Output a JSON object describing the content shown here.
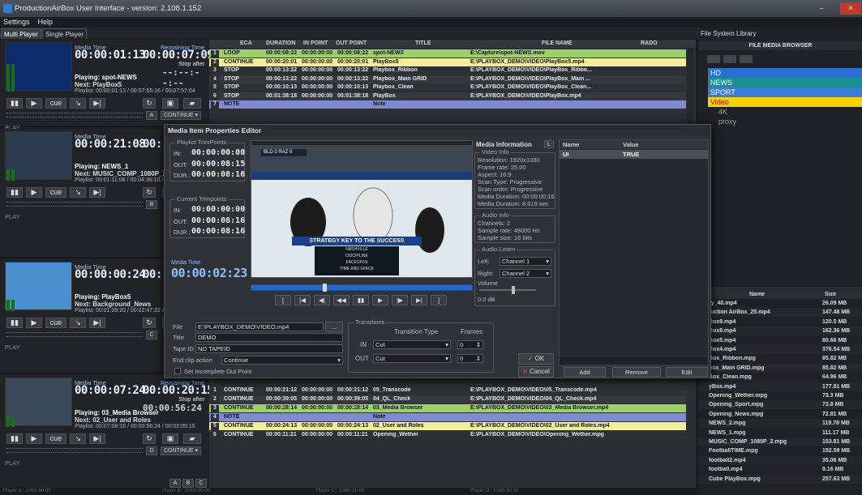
{
  "window": {
    "title": "ProductionAirBox User Interface - version: 2.108.1.152",
    "min": "–",
    "max": "□",
    "close": "✕"
  },
  "menu": [
    "Settings",
    "Help"
  ],
  "tabs": [
    "Multi Player",
    "Single Player"
  ],
  "players": [
    {
      "media_label": "Media Time",
      "media_time": "00:00:01:13",
      "remain_label": "Remaining Time",
      "remain_time": "00:00:07:09",
      "stop_after": "Stop after",
      "dashes": "--:--:--:--",
      "playing": "Playing: spot-NEWS",
      "next": "Next: PlayBox5",
      "playlist": "Playlist: 00:00:01:13 / 00:07:55:16 / 00:07:57:04",
      "letter": "A",
      "cont": "CONTINUE",
      "state": "PLAY"
    },
    {
      "media_label": "Media Time",
      "media_time": "00:00:21:08",
      "remain_label": "",
      "remain_time": "00:",
      "playing": "Playing: NEWS_1",
      "next": "Next: MUSIC_COMP_1080P_2",
      "playlist": "Playlist: 00:01:11:08 / 00:04:36:10 /",
      "letter": "B",
      "state": "PLAY"
    },
    {
      "media_label": "Media Time",
      "media_time": "00:00:00:24",
      "remain_label": "",
      "remain_time": "00:",
      "remain_time2": "00:",
      "playing": "Playing: PlayBox5",
      "next": "Next: Background_News",
      "playlist": "Playlist: 00:01:09:20 / 00:02:47:22 /",
      "letter": "C",
      "state": "PLAY"
    },
    {
      "media_label": "Media Time",
      "media_time": "00:00:07:24",
      "remain_label": "Remaining Time",
      "remain_time": "00:00:20:15",
      "stop_after": "Stop after",
      "dashes": "00:00:56:24",
      "playing": "Playing: 03_Media Browser",
      "next": "Next: 02_User and Roles",
      "playlist": "Playlist: 00:07:08:16 / 00:00:56:24 / 00:02:05:15",
      "letter": "D",
      "cont": "CONTINUE",
      "state": "PLAY"
    }
  ],
  "grid_headers": [
    "ECA",
    "DURATION",
    "IN POINT",
    "OUT POINT",
    "TITLE",
    "FILE NAME",
    "RADO"
  ],
  "grid1": [
    {
      "n": "1",
      "eca": "LOOP",
      "dur": "00:00:08:22",
      "in": "00:00:00:00",
      "out": "00:00:08:22",
      "title": "spot-NEWS",
      "file": "E:\\Capture\\spot-NEWS.mov",
      "bg": "#9bd06a",
      "fg": "#101010"
    },
    {
      "n": "2",
      "eca": "CONTINUE",
      "dur": "00:00:20:01",
      "in": "00:00:00:00",
      "out": "00:00:20:01",
      "title": "PlayBox5",
      "file": "E:\\PLAYBOX_DEMO\\VIDEO\\PlayBox5.mp4",
      "bg": "#f2ef9c",
      "fg": "#101010"
    },
    {
      "n": "3",
      "eca": "STOP",
      "dur": "00:00:13:22",
      "in": "00:00:00:00",
      "out": "00:00:13:22",
      "title": "Playbox_Ribbon",
      "file": "E:\\PLAYBOX_DEMO\\VIDEO\\PlayBox_Ribbo...",
      "bg": "#2d3034",
      "fg": "#e8e8e8"
    },
    {
      "n": "4",
      "eca": "STOP",
      "dur": "00:00:13:22",
      "in": "00:00:00:00",
      "out": "00:00:13:22",
      "title": "Playbox_Main GRID",
      "file": "E:\\PLAYBOX_DEMO\\VIDEO\\PlayBox_Main ...",
      "bg": "#35383d",
      "fg": "#e8e8e8"
    },
    {
      "n": "5",
      "eca": "STOP",
      "dur": "00:00:10:13",
      "in": "00:00:00:00",
      "out": "00:00:10:13",
      "title": "Playbox_Clean",
      "file": "E:\\PLAYBOX_DEMO\\VIDEO\\PlayBox_Clean...",
      "bg": "#2d3034",
      "fg": "#e8e8e8"
    },
    {
      "n": "6",
      "eca": "STOP",
      "dur": "00:01:38:18",
      "in": "00:00:00:00",
      "out": "00:01:38:18",
      "title": "PlayBox",
      "file": "E:\\PLAYBOX_DEMO\\VIDEO\\PlayBox.mp4",
      "bg": "#35383d",
      "fg": "#e8e8e8"
    },
    {
      "n": "7",
      "eca": "NOTE",
      "dur": "",
      "in": "",
      "out": "",
      "title": "Note",
      "file": "",
      "bg": "#7f8ad0",
      "fg": "#101010"
    }
  ],
  "grid4": [
    {
      "n": "1",
      "eca": "CONTINUE",
      "dur": "00:00:21:12",
      "in": "00:00:00:00",
      "out": "00:00:21:12",
      "title": "05_Transcode",
      "file": "E:\\PLAYBOX_DEMO\\VIDEO\\05_Transcode.mp4",
      "bg": "#2d3034",
      "fg": "#e8e8e8"
    },
    {
      "n": "2",
      "eca": "CONTINUE",
      "dur": "00:00:39:05",
      "in": "00:00:00:00",
      "out": "00:00:39:05",
      "title": "04_QL_Check",
      "file": "E:\\PLAYBOX_DEMO\\VIDEO\\04_QL_Check.mp4",
      "bg": "#35383d",
      "fg": "#e8e8e8"
    },
    {
      "n": "3",
      "eca": "CONTINUE",
      "dur": "00:00:28:14",
      "in": "00:00:00:00",
      "out": "00:00:28:14",
      "title": "03_Media Browser",
      "file": "E:\\PLAYBOX_DEMO\\VIDEO\\03_Media Browser.mp4",
      "bg": "#9bd06a",
      "fg": "#101010"
    },
    {
      "n": "4",
      "eca": "NOTE",
      "dur": "",
      "in": "",
      "out": "",
      "title": "Note",
      "file": "",
      "bg": "#7f8ad0",
      "fg": "#101010"
    },
    {
      "n": "5",
      "eca": "CONTINUE",
      "dur": "00:00:24:13",
      "in": "00:00:00:00",
      "out": "00:00:24:13",
      "title": "02_User and Roles",
      "file": "E:\\PLAYBOX_DEMO\\VIDEO\\02_User and Roles.mp4",
      "bg": "#f2ef9c",
      "fg": "#101010"
    },
    {
      "n": "6",
      "eca": "CONTINUE",
      "dur": "00:00:11:21",
      "in": "00:00:00:00",
      "out": "00:00:11:21",
      "title": "Opening_Wether",
      "file": "E:\\PLAYBOX_DEMO\\VIDEO\\Opening_Wether.mpg",
      "bg": "#2d3034",
      "fg": "#e8e8e8"
    }
  ],
  "fsl": {
    "tab": "File System Library",
    "browser": "FILE MEDIA BROWSER",
    "tree": [
      {
        "label": "HD",
        "bg": "#2a6fd6",
        "fg": "#ffffff"
      },
      {
        "label": "NEWS",
        "bg": "#1a8f8f",
        "fg": "#ffffff"
      },
      {
        "label": "SPORT",
        "bg": "#3a7bd5",
        "fg": "#ffffff"
      },
      {
        "label": "Video",
        "bg": "#f1d400",
        "fg": "#c00000"
      },
      {
        "label": "4K",
        "bg": "",
        "fg": "#9a9ea2"
      },
      {
        "label": "proxy",
        "bg": "",
        "fg": "#9a9ea2"
      }
    ],
    "col_name": "Name",
    "col_size": "Size",
    "files": [
      {
        "name": "ry_40.mp4",
        "size": "26.09 MB"
      },
      {
        "name": "luction AirBox_25.mp4",
        "size": "147.48 MB"
      },
      {
        "name": "Box9.mp4",
        "size": "120.5 MB"
      },
      {
        "name": "Box8.mp4",
        "size": "162.36 MB"
      },
      {
        "name": "Box5.mp4",
        "size": "80.66 MB"
      },
      {
        "name": "Box4.mp4",
        "size": "376.54 MB"
      },
      {
        "name": "Box_Ribbon.mpg",
        "size": "85.82 MB"
      },
      {
        "name": "box_Main GRID.mpg",
        "size": "85.82 MB"
      },
      {
        "name": "Box_Clean.mpg",
        "size": "64.96 MB"
      },
      {
        "name": "yBox.mp4",
        "size": "177.81 MB"
      },
      {
        "name": "Opening_Wether.mpg",
        "size": "73.3 MB"
      },
      {
        "name": "Opening_Sport.mpg",
        "size": "73.8 MB"
      },
      {
        "name": "Opening_News.mpg",
        "size": "72.81 MB"
      },
      {
        "name": "NEWS_2.mpg",
        "size": "119.78 MB"
      },
      {
        "name": "NEWS_1.mpg",
        "size": "111.17 MB"
      },
      {
        "name": "MUSIC_COMP_1080P_2.mpg",
        "size": "153.81 MB"
      },
      {
        "name": "FootballTIME.mpg",
        "size": "192.59 MB"
      },
      {
        "name": "football2.mp4",
        "size": "35.06 MB"
      },
      {
        "name": "football.mp4",
        "size": "9.16 MB"
      },
      {
        "name": "Cube PlayBox.mpg",
        "size": "257.63 MB"
      }
    ]
  },
  "dialog": {
    "title": "Media Item Properties Editor",
    "pl_trim_legend": "Playlist TrimPoints",
    "in_lbl": "IN:",
    "in_val": "00:00:00:00",
    "out_lbl": "OUT:",
    "out_val": "00:00:08:15",
    "dur_lbl": "DUR.:",
    "dur_val": "00:00:08:16",
    "cur_trim_legend": "Current Trimpoints",
    "cin_val": "00:00:00:00",
    "cout_val": "00:00:08:16",
    "cdur_val": "00:00:08:16",
    "media_time_lbl": "Media Time",
    "media_time": "00:00:02:23",
    "video_caption": "STRATEGY KEY TO THE SUCCESS",
    "video_list": [
      "NASHVILLE",
      "DISCIPLINE",
      "FACEOFFS",
      "TIME AND SPACE"
    ],
    "media_info_title": "Media Information",
    "video_info_legend": "Video Info",
    "video_info": [
      "Resolution: 1920x1080",
      "Frame rate: 25.00",
      "Aspect: 16:9",
      "Scan Type: Progressive",
      "Scan order: Progressive",
      "Media Duration: 00:00:00:16",
      "Media Duration: 8.619 sec"
    ],
    "audio_info_legend": "Audio Info",
    "audio_info": [
      "Channels: 2",
      "Sample rate: 48000 Hz",
      "Sample size: 16 bits"
    ],
    "audio_listen_legend": "Audio Listen",
    "left_lbl": "Left:",
    "left_val": "Channel 1",
    "right_lbl": "Right:",
    "right_val": "Channel 2",
    "volume_lbl": "Volume",
    "volume_db": "0.0 dB",
    "name_col": "Name",
    "value_col": "Value",
    "prop_name": "UI",
    "prop_value": "TRUE",
    "file_lbl": "File",
    "file_val": "E:\\PLAYBOX_DEMO\\VIDEO.mp4",
    "browse": "...",
    "title_lbl": "Title",
    "title_val": "DEMO",
    "tape_lbl": "Tape ID",
    "tape_val": "NO TAPEID",
    "endclip_lbl": "End clip action",
    "endclip_val": "Continue",
    "incomplete_lbl": "Set Incomplete Out Point",
    "transitions_legend": "Transitions",
    "trans_type_lbl": "Transition Type",
    "frames_lbl": "Frames",
    "tin_lbl": "IN",
    "tin_val": "Cut",
    "tin_frames": "0",
    "tout_lbl": "OUT",
    "tout_val": "Cut",
    "tout_frames": "0",
    "ok": "OK",
    "cancel": "Cancel",
    "add": "Add",
    "remove": "Remove",
    "edit": "Edit",
    "scoreboard": "BLD 0 RAZ 0"
  },
  "bottom_letters": [
    "A",
    "B",
    "C"
  ],
  "status": [
    "Player A:: 1080i 50.00",
    "Player B:: 1080i 50.00",
    "Player C:: 1080i 50.00",
    "Player D:: 1080i 50.00"
  ],
  "colors": {
    "accent": "#2f7fd0",
    "timecode": "#8fc0ff"
  }
}
